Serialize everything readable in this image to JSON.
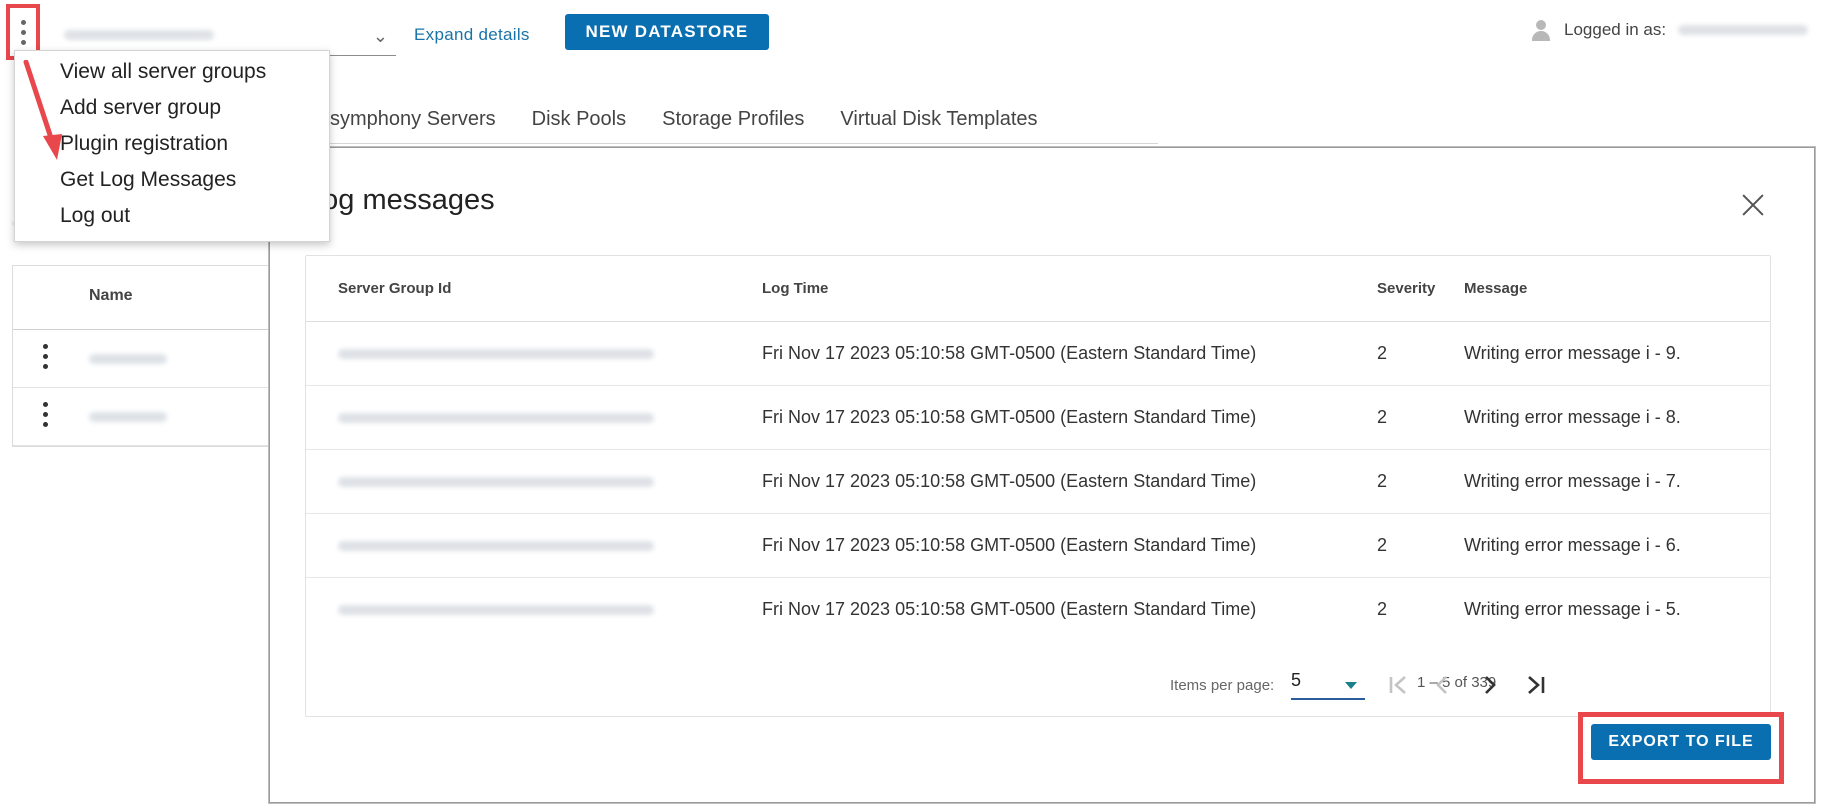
{
  "header": {
    "server_group_select": "",
    "expand_link": "Expand details",
    "new_datastore_label": "NEW DATASTORE",
    "logged_in_label": "Logged in as:"
  },
  "menu": {
    "items": [
      {
        "label": "View all server groups"
      },
      {
        "label": "Add server group"
      },
      {
        "label": "Plugin registration"
      },
      {
        "label": "Get Log Messages"
      },
      {
        "label": "Log out"
      }
    ]
  },
  "tabs": [
    {
      "label": "symphony Servers"
    },
    {
      "label": "Disk Pools"
    },
    {
      "label": "Storage Profiles"
    },
    {
      "label": "Virtual Disk Templates"
    }
  ],
  "left_table": {
    "name_header": "Name"
  },
  "modal": {
    "title": "Log messages",
    "columns": {
      "server_group_id": "Server Group Id",
      "log_time": "Log Time",
      "severity": "Severity",
      "message": "Message"
    },
    "rows": [
      {
        "log_time": "Fri Nov 17 2023 05:10:58 GMT-0500 (Eastern Standard Time)",
        "severity": "2",
        "message": "Writing error message i - 9."
      },
      {
        "log_time": "Fri Nov 17 2023 05:10:58 GMT-0500 (Eastern Standard Time)",
        "severity": "2",
        "message": "Writing error message i - 8."
      },
      {
        "log_time": "Fri Nov 17 2023 05:10:58 GMT-0500 (Eastern Standard Time)",
        "severity": "2",
        "message": "Writing error message i - 7."
      },
      {
        "log_time": "Fri Nov 17 2023 05:10:58 GMT-0500 (Eastern Standard Time)",
        "severity": "2",
        "message": "Writing error message i - 6."
      },
      {
        "log_time": "Fri Nov 17 2023 05:10:58 GMT-0500 (Eastern Standard Time)",
        "severity": "2",
        "message": "Writing error message i - 5."
      }
    ],
    "pagination": {
      "items_per_page_label": "Items per page:",
      "items_per_page_value": "5",
      "range_text": "1 – 5 of 339"
    },
    "export_label": "EXPORT TO FILE"
  },
  "icons": {
    "menu_toggle": "kebab-vertical-icon",
    "user": "user-icon",
    "close": "close-icon",
    "first_page": "first-page-icon",
    "prev_page": "chevron-left-icon",
    "next_page": "chevron-right-icon",
    "last_page": "last-page-icon"
  },
  "colors": {
    "primary": "#0a6fb0",
    "link": "#1a73a8",
    "highlight_red": "#e8474b"
  }
}
